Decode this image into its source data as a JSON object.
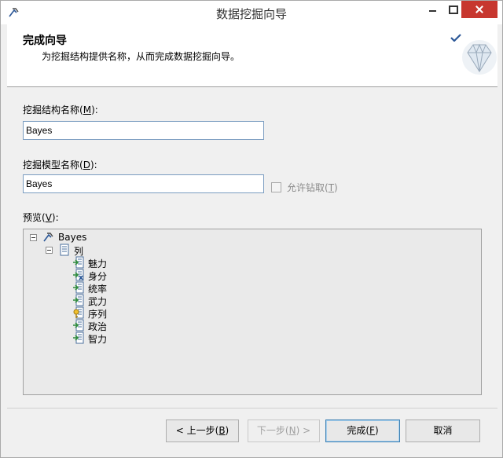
{
  "window": {
    "title": "数据挖掘向导"
  },
  "header": {
    "title": "完成向导",
    "subtitle": "为挖掘结构提供名称，从而完成数据挖掘向导。"
  },
  "structure_name": {
    "label": "挖掘结构名称",
    "hotkey": "M",
    "value": "Bayes"
  },
  "model_name": {
    "label": "挖掘模型名称",
    "hotkey": "D",
    "value": "Bayes"
  },
  "allow_drillthrough": {
    "label": "允许钻取",
    "hotkey": "T",
    "checked": false,
    "enabled": false
  },
  "preview": {
    "label": "预览",
    "hotkey": "V",
    "root": {
      "label": "Bayes",
      "icon": "mining-model-icon",
      "expanded": true
    },
    "folder": {
      "label": "列",
      "icon": "column-list-icon",
      "expanded": true
    },
    "columns": [
      {
        "label": "魅力",
        "icon": "input-column-icon"
      },
      {
        "label": "身分",
        "icon": "predict-column-icon"
      },
      {
        "label": "统率",
        "icon": "input-column-icon"
      },
      {
        "label": "武力",
        "icon": "input-column-icon"
      },
      {
        "label": "序列",
        "icon": "key-column-icon"
      },
      {
        "label": "政治",
        "icon": "input-column-icon"
      },
      {
        "label": "智力",
        "icon": "input-column-icon"
      }
    ]
  },
  "buttons": {
    "back": {
      "label": "< 上一步",
      "hotkey": "B"
    },
    "next": {
      "label": "下一步",
      "hotkey": "N",
      "suffix": " >"
    },
    "finish": {
      "label": "完成",
      "hotkey": "F"
    },
    "cancel": {
      "label": "取消"
    }
  },
  "colors": {
    "accent": "#3c7fb1",
    "close": "#c7372f",
    "input_border": "#7a9cc0"
  }
}
